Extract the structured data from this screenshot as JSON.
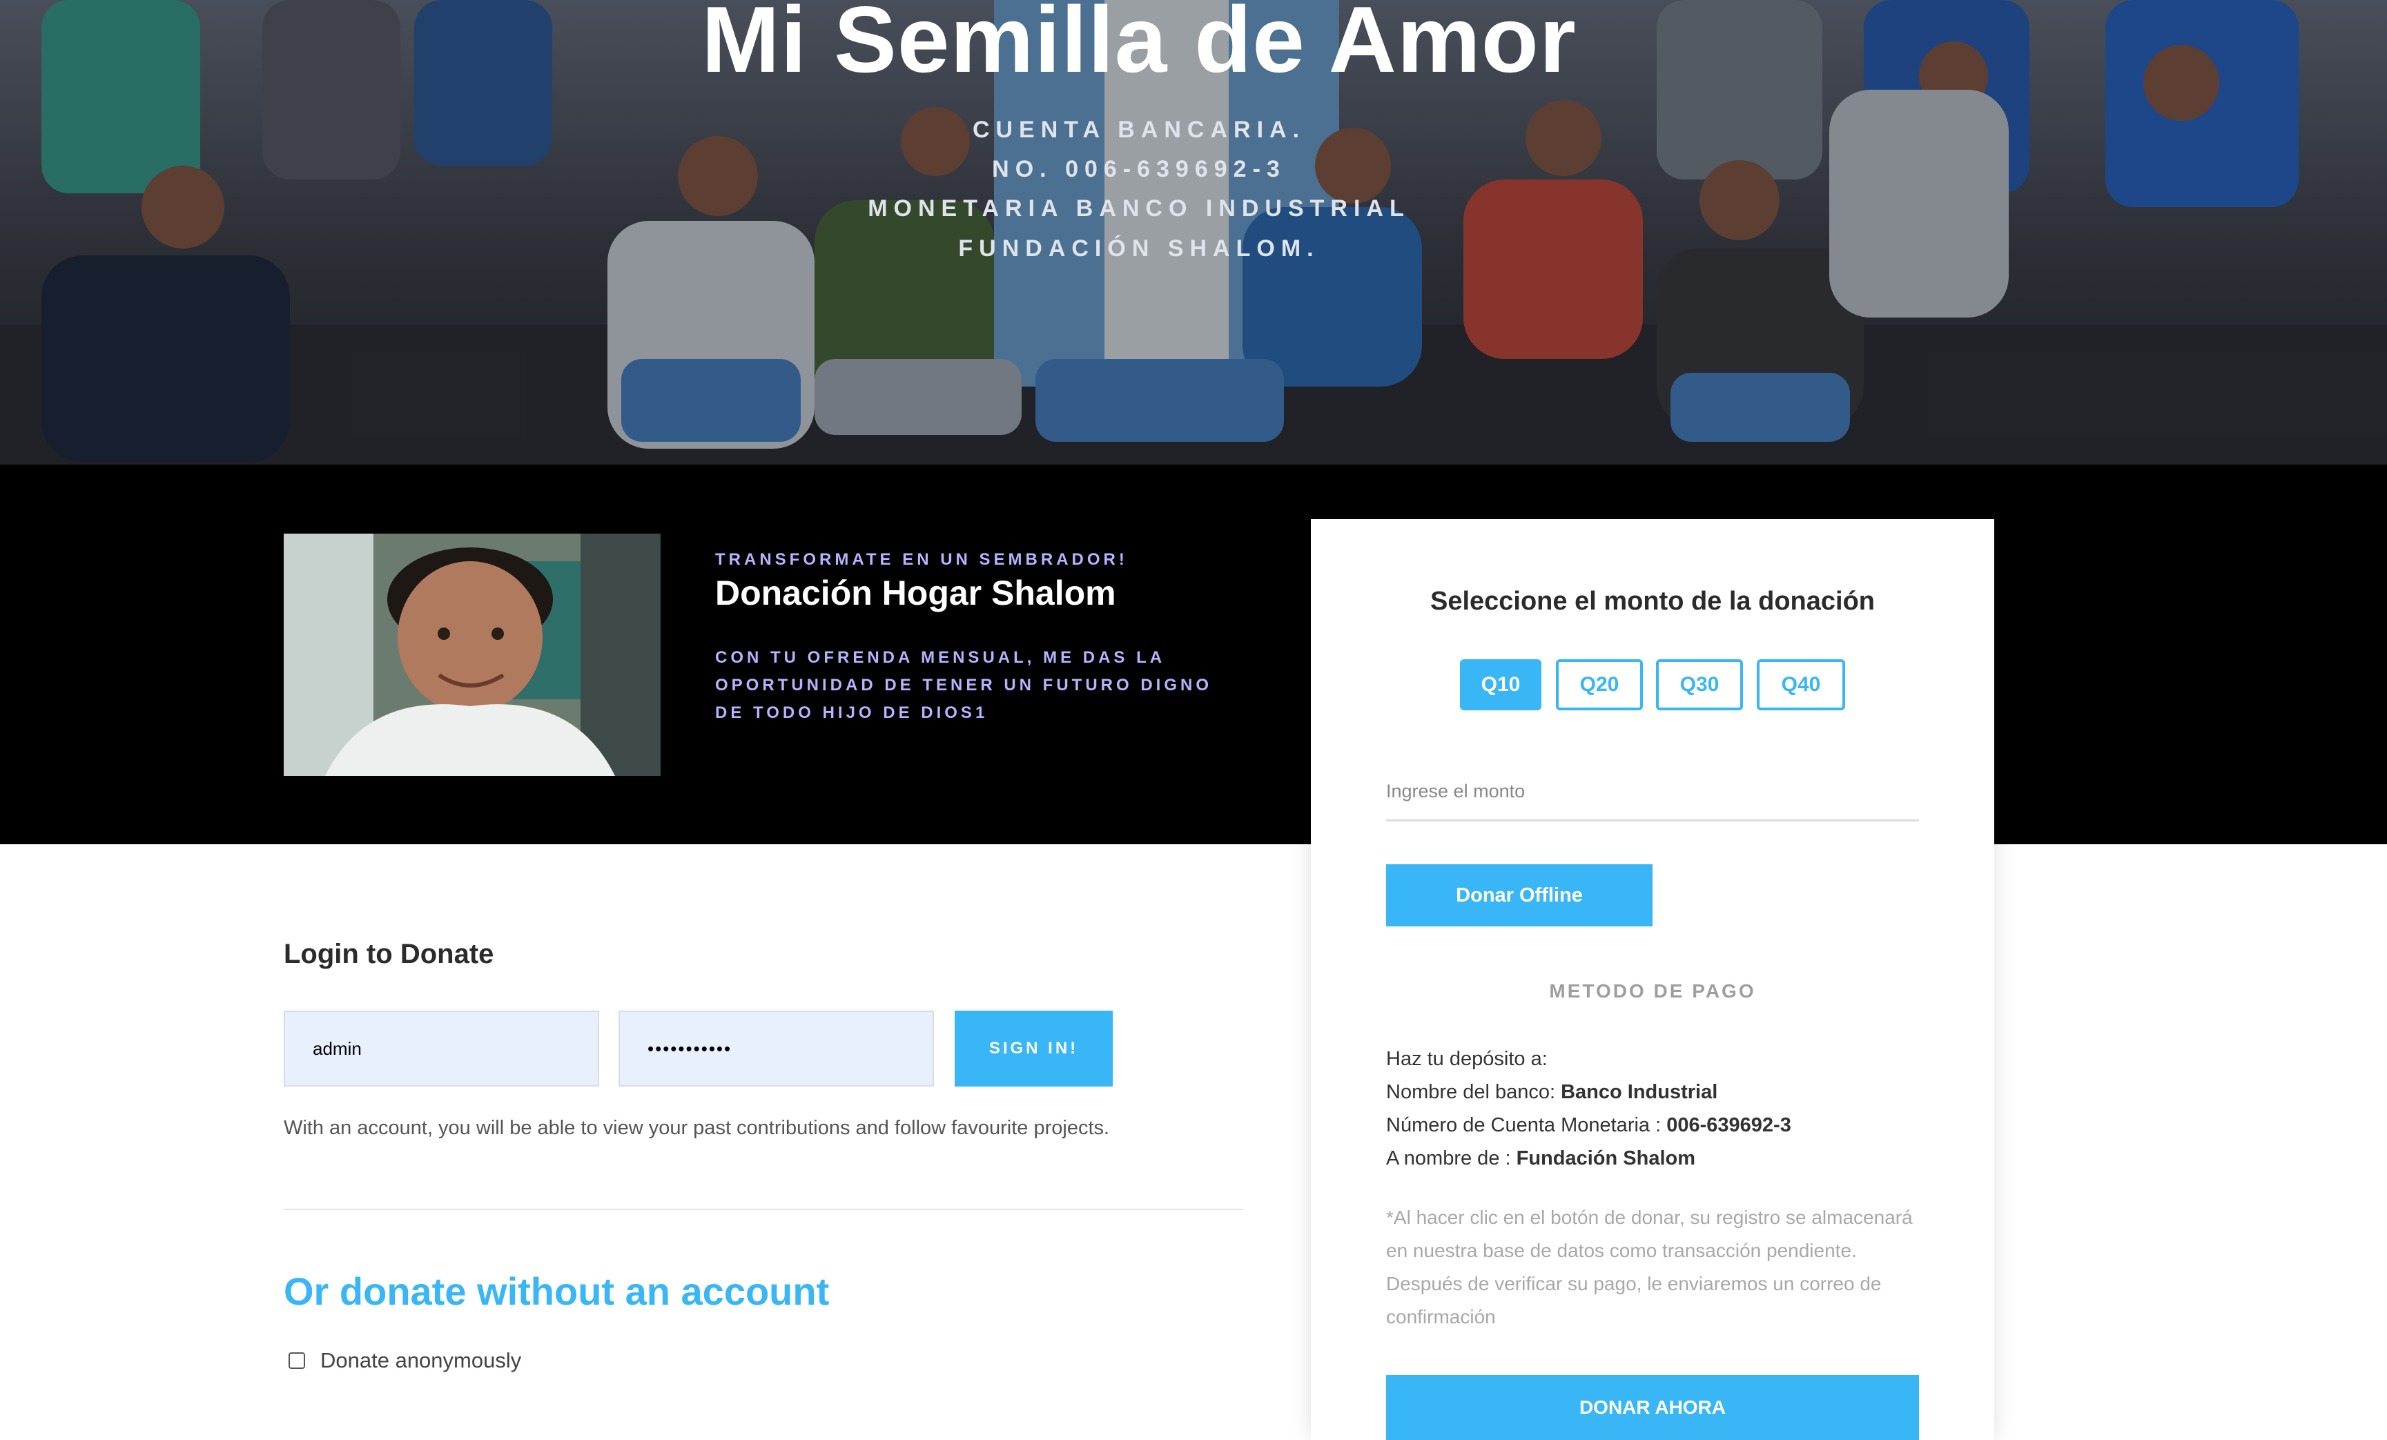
{
  "hero": {
    "title": "Mi Semilla de Amor",
    "lines": [
      "CUENTA BANCARIA.",
      "NO. 006-639692-3",
      "MONETARIA BANCO INDUSTRIAL",
      "FUNDACIÓN SHALOM."
    ]
  },
  "campaign": {
    "kicker": "TRANSFORMATE EN UN SEMBRADOR!",
    "title": "Donación Hogar Shalom",
    "description": "CON TU OFRENDA MENSUAL, ME DAS LA OPORTUNIDAD DE TENER UN FUTURO DIGNO DE TODO HIJO DE DIOS1"
  },
  "donation": {
    "title": "Seleccione el monto de la donación",
    "amounts": [
      "Q10",
      "Q20",
      "Q30",
      "Q40"
    ],
    "selected_amount": "Q10",
    "amount_placeholder": "Ingrese el monto",
    "offline_button": "Donar Offline",
    "payment_method_label": "METODO DE PAGO",
    "deposit_intro": "Haz tu depósito a:",
    "bank_label": "Nombre del banco:",
    "bank_value": "Banco Industrial",
    "account_label": "Número de Cuenta Monetaria :",
    "account_value": "006-639692-3",
    "owner_label": "A nombre de :",
    "owner_value": "Fundación Shalom",
    "note": "*Al hacer clic en el botón de donar, su registro se almacenará en nuestra base de datos como transacción pendiente. Después de verificar su pago, le enviaremos un correo de confirmación",
    "donate_now_button": "DONAR AHORA"
  },
  "login": {
    "title": "Login to Donate",
    "username_value": "admin",
    "password_value": "•••••••••••",
    "signin_button": "SIGN IN!",
    "help_text": "With an account, you will be able to view your past contributions and follow favourite projects.",
    "alt_title": "Or donate without an account",
    "anonymous_label": "Donate anonymously"
  },
  "colors": {
    "accent": "#38b6f5",
    "lavender": "#b8b2ff",
    "band": "#000000"
  }
}
